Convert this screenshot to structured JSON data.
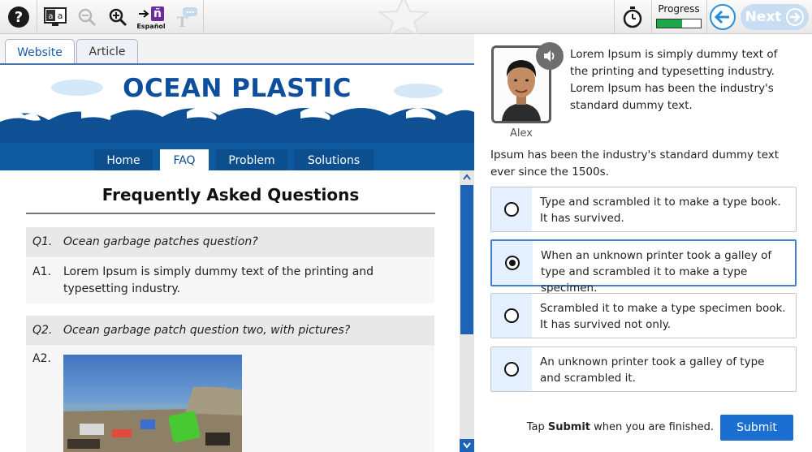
{
  "toolbar": {
    "espanol_label": "Español",
    "espanol_glyph": "ñ",
    "progress_label": "Progress",
    "progress_fraction": 0.58,
    "next_label": "Next",
    "icons": [
      "help-icon",
      "text-reader-icon",
      "zoom-out-icon",
      "zoom-in-icon",
      "translate-icon",
      "text-chat-icon",
      "timer-icon",
      "back-arrow-icon",
      "next-arrow-icon"
    ],
    "accent_color": "#2a8dd8",
    "progress_color": "#1fa64a"
  },
  "left": {
    "tabs": [
      {
        "label": "Website",
        "active": true
      },
      {
        "label": "Article",
        "active": false
      }
    ],
    "site_title": "OCEAN PLASTIC",
    "nav": [
      {
        "label": "Home",
        "active": false
      },
      {
        "label": "FAQ",
        "active": true
      },
      {
        "label": "Problem",
        "active": false
      },
      {
        "label": "Solutions",
        "active": false
      }
    ],
    "faq": {
      "heading": "Frequently Asked Questions",
      "items": [
        {
          "q_num": "Q1.",
          "q_text": "Ocean garbage patches question?",
          "a_num": "A1.",
          "a_text": "Lorem Ipsum is simply dummy text of the printing and typesetting industry."
        },
        {
          "q_num": "Q2.",
          "q_text": "Ocean garbage patch question two, with pictures?",
          "a_num": "A2.",
          "a_text": ""
        }
      ]
    }
  },
  "right": {
    "avatar_name": "Alex",
    "speech_text": "Lorem Ipsum is simply dummy text of the printing and typesetting industry. Lorem Ipsum has been the industry's standard dummy text.",
    "question": "Ipsum has been the industry's standard dummy text ever since the 1500s.",
    "options": [
      {
        "text": "Type and scrambled it to make a type book. It has survived.",
        "selected": false
      },
      {
        "text": "When an unknown printer took a galley of type and scrambled it to make a type specimen.",
        "selected": true
      },
      {
        "text": "Scrambled it to make a type specimen book. It has survived not only.",
        "selected": false
      },
      {
        "text": "An unknown printer took a galley of type and scrambled it.",
        "selected": false
      }
    ],
    "hint_prefix": "Tap ",
    "hint_bold": "Submit",
    "hint_suffix": " when you are finished.",
    "submit_label": "Submit",
    "submit_color": "#1a6fd0"
  }
}
